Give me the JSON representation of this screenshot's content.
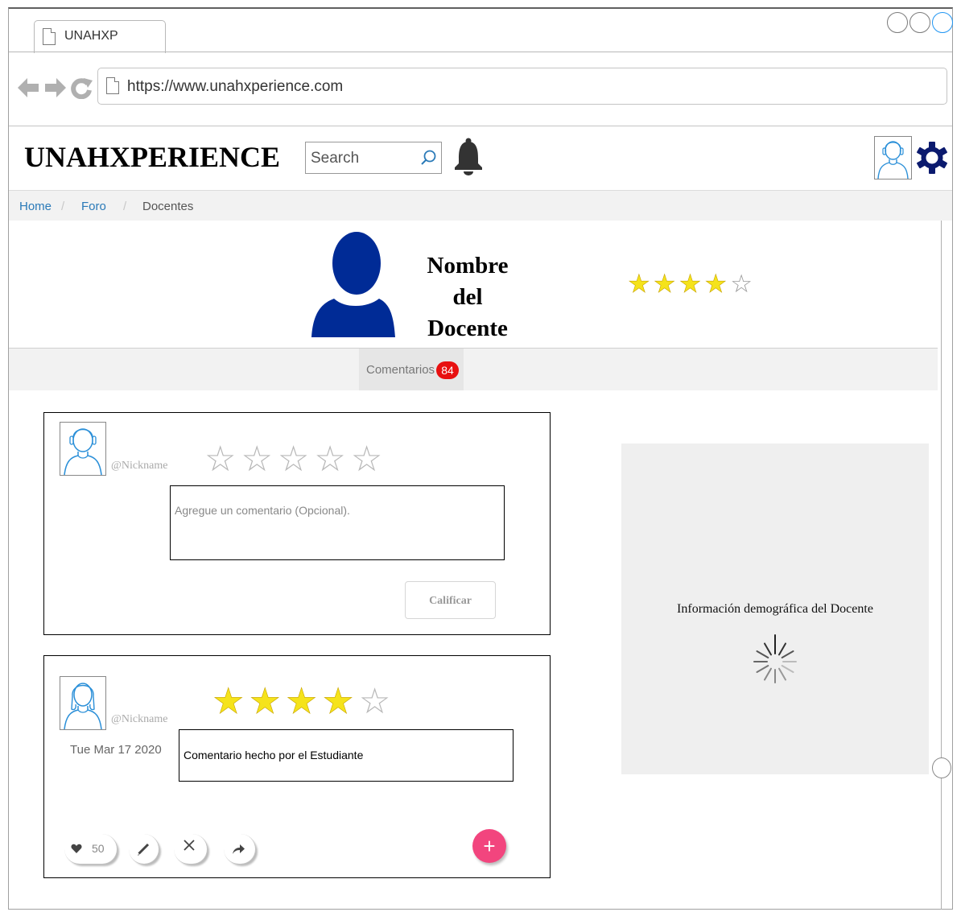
{
  "browser": {
    "tab_title": "UNAHXP",
    "url": "https://www.unahxperience.com"
  },
  "header": {
    "brand": "UNAHXPERIENCE",
    "search_placeholder": "Search"
  },
  "breadcrumb": {
    "items": [
      "Home",
      "Foro",
      "Docentes"
    ],
    "separator": "/"
  },
  "profile": {
    "name_lines": [
      "Nombre",
      "del",
      "Docente"
    ],
    "rating": 4,
    "rating_max": 5
  },
  "tabs": {
    "comments_label": "Comentarios",
    "comments_count": "84"
  },
  "new_comment": {
    "nickname": "@Nickname",
    "rating": 0,
    "rating_max": 5,
    "placeholder": "Agregue un comentario (Opcional).",
    "submit_label": "Calificar"
  },
  "comment": {
    "nickname": "@Nickname",
    "rating": 4,
    "rating_max": 5,
    "date": "Tue Mar 17 2020",
    "text": "Comentario hecho por el Estudiante",
    "likes": "50"
  },
  "side_panel": {
    "text": "Información demográfica del Docente"
  },
  "colors": {
    "avatar_fill": "#002b96",
    "star_on": "#f5e31b",
    "badge": "#e81010",
    "fab": "#f2457e",
    "link": "#2a7ab8"
  }
}
